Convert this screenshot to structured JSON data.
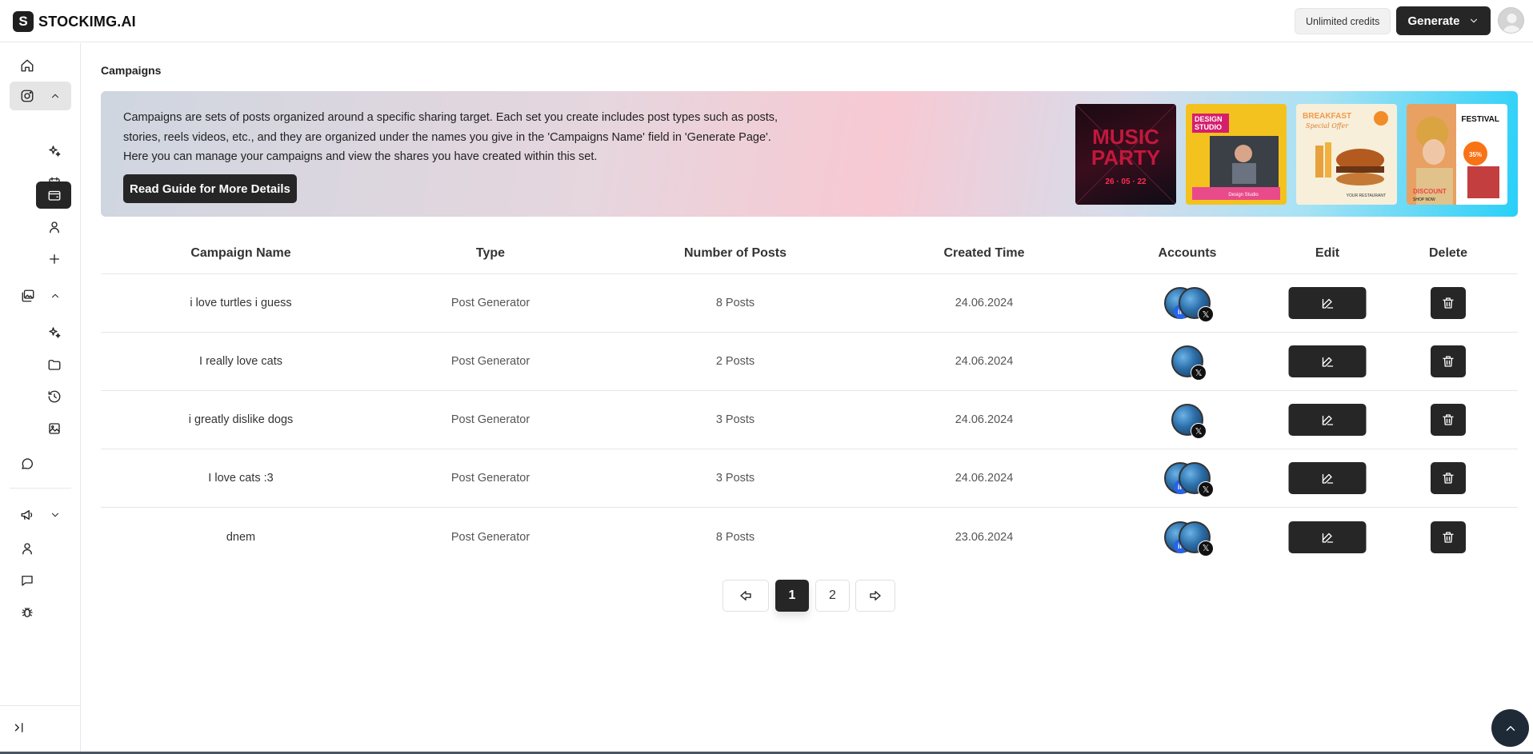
{
  "brand": {
    "logo_letter": "S",
    "name": "STOCKIMG.AI"
  },
  "header": {
    "credits": "Unlimited credits",
    "generate_label": "Generate"
  },
  "page": {
    "title": "Campaigns"
  },
  "banner": {
    "line1": "Campaigns are sets of posts organized around a specific sharing target. Each set you create includes post types such as posts,",
    "line2": "stories, reels videos, etc., and they are organized under the names you give in the 'Campaigns Name' field in 'Generate Page'.",
    "line3": "Here you can manage your campaigns and view the shares you have created within this set.",
    "button": "Read Guide for More Details",
    "thumbs": [
      {
        "title": "MUSIC",
        "sub": "PARTY",
        "meta": "26 · 05 · 22"
      },
      {
        "title": "DESIGN",
        "sub": "STUDIO",
        "meta": "Design Studio"
      },
      {
        "title": "BREAKFAST",
        "sub": "Special Offer",
        "meta": "YOUR RESTAURANT"
      },
      {
        "title": "FESTIVAL",
        "sub": "DISCOUNT",
        "meta": "SHOP NOW"
      }
    ]
  },
  "table": {
    "headers": {
      "name": "Campaign Name",
      "type": "Type",
      "posts": "Number of Posts",
      "created": "Created Time",
      "accounts": "Accounts",
      "edit": "Edit",
      "delete": "Delete"
    },
    "rows": [
      {
        "name": "i love turtles i guess",
        "type": "Post Generator",
        "posts": "8 Posts",
        "created": "24.06.2024"
      },
      {
        "name": "I really love cats",
        "type": "Post Generator",
        "posts": "2 Posts",
        "created": "24.06.2024"
      },
      {
        "name": "i greatly dislike dogs",
        "type": "Post Generator",
        "posts": "3 Posts",
        "created": "24.06.2024"
      },
      {
        "name": "I love cats :3",
        "type": "Post Generator",
        "posts": "3 Posts",
        "created": "24.06.2024"
      },
      {
        "name": "dnem",
        "type": "Post Generator",
        "posts": "8 Posts",
        "created": "23.06.2024"
      }
    ]
  },
  "pagination": {
    "pages": [
      "1",
      "2"
    ],
    "current": "1"
  },
  "icons": {
    "sidebar": [
      "home-icon",
      "instagram-icon",
      "sparkles-icon",
      "calendar-icon",
      "wallet-icon",
      "user-icon",
      "plus-icon",
      "images-icon",
      "sparkles-icon",
      "folder-icon",
      "history-icon",
      "image-icon",
      "chat-icon",
      "megaphone-icon",
      "user-icon",
      "message-icon",
      "bug-icon",
      "collapse-icon"
    ]
  },
  "colors": {
    "primary": "#262626",
    "banner_start": "#cfd6e0",
    "banner_mid": "#f7c9d3",
    "banner_end": "#28d0f8"
  }
}
